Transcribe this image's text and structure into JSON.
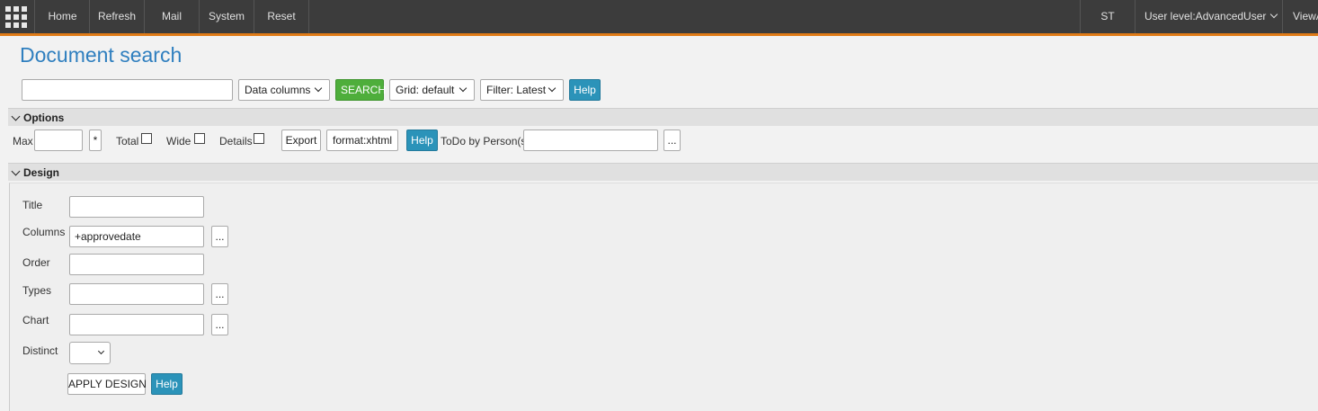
{
  "topbar": {
    "apps_icon": "apps-grid-icon",
    "nav": [
      "Home",
      "Refresh",
      "Mail",
      "System",
      "Reset"
    ],
    "user_initials": "ST",
    "user_level": "User level:AdvancedUser",
    "view": "ViewA"
  },
  "page": {
    "title": "Document search"
  },
  "search": {
    "query_value": "",
    "data_columns": "Data columns",
    "search_label": "SEARCH",
    "grid": "Grid: default",
    "filter": "Filter: Latest",
    "help": "Help"
  },
  "options": {
    "header": "Options",
    "max_label": "Max",
    "max_value": "",
    "star": "*",
    "total_label": "Total",
    "wide_label": "Wide",
    "details_label": "Details",
    "export": "Export",
    "format": "format:xhtml",
    "help": "Help",
    "todo_label": "ToDo by Person(s)",
    "todo_value": "",
    "more": "..."
  },
  "design": {
    "header": "Design",
    "title_label": "Title",
    "title_value": "",
    "columns_label": "Columns",
    "columns_value": "+approvedate",
    "order_label": "Order",
    "order_value": "",
    "types_label": "Types",
    "types_value": "",
    "chart_label": "Chart",
    "chart_value": "",
    "distinct_label": "Distinct",
    "more": "...",
    "apply": "APPLY DESIGN",
    "help": "Help"
  },
  "colors": {
    "accent": "#e07b17",
    "title": "#2f7fbf",
    "green": "#4eae3b",
    "blue": "#2b93b9",
    "topbar": "#3c3c3c"
  }
}
